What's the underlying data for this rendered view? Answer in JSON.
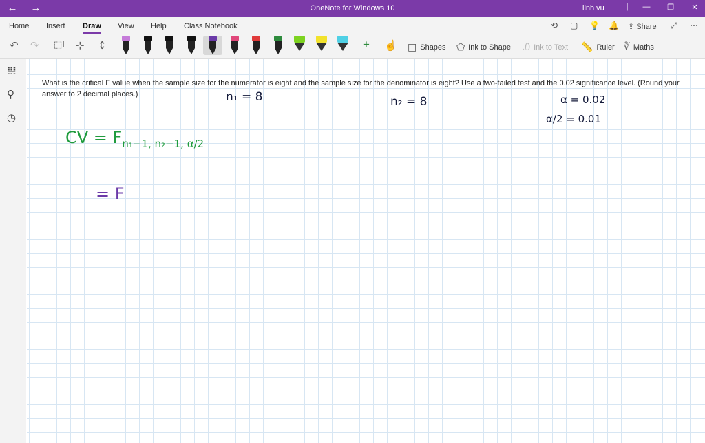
{
  "window": {
    "title": "OneNote for Windows 10",
    "user": "linh vu"
  },
  "menu": {
    "tabs": [
      "Home",
      "Insert",
      "Draw",
      "View",
      "Help",
      "Class Notebook"
    ],
    "active": "Draw",
    "share_label": "Share"
  },
  "ribbon": {
    "pens": [
      {
        "kind": "pen",
        "color": "#c57bd9"
      },
      {
        "kind": "pen",
        "color": "#111111"
      },
      {
        "kind": "pen",
        "color": "#111111"
      },
      {
        "kind": "pen",
        "color": "#111111"
      },
      {
        "kind": "pen",
        "color": "#6a3aa8"
      },
      {
        "kind": "pen",
        "color": "#e0477a"
      },
      {
        "kind": "pen",
        "color": "#e03a3a"
      },
      {
        "kind": "pen",
        "color": "#2e8b3d"
      },
      {
        "kind": "highlighter",
        "color": "#7dd320"
      },
      {
        "kind": "highlighter",
        "color": "#f2e22b"
      },
      {
        "kind": "highlighter",
        "color": "#4fd0e5"
      }
    ],
    "shapes_label": "Shapes",
    "ink_to_shape_label": "Ink to Shape",
    "ink_to_text_label": "Ink to Text",
    "ruler_label": "Ruler",
    "maths_label": "Maths"
  },
  "page": {
    "question_part1": "What is the critical F value when the sample size for the numerator is eight and the sample size for the denominator is eight? Use a two-tailed test and the 0.02 significance level. (Round your",
    "question_part2": "answer to 2 decimal places.)"
  },
  "ink": {
    "n1": "n₁ = 8",
    "n2": "n₂ = 8",
    "alpha": "α = 0.02",
    "alpha_half_lhs": "α/2",
    "alpha_half_rhs": "= 0.01",
    "cv_lhs": "CV  =  F",
    "cv_sub": "n₁−1, n₂−1, α/2",
    "eq2": "=  F"
  }
}
